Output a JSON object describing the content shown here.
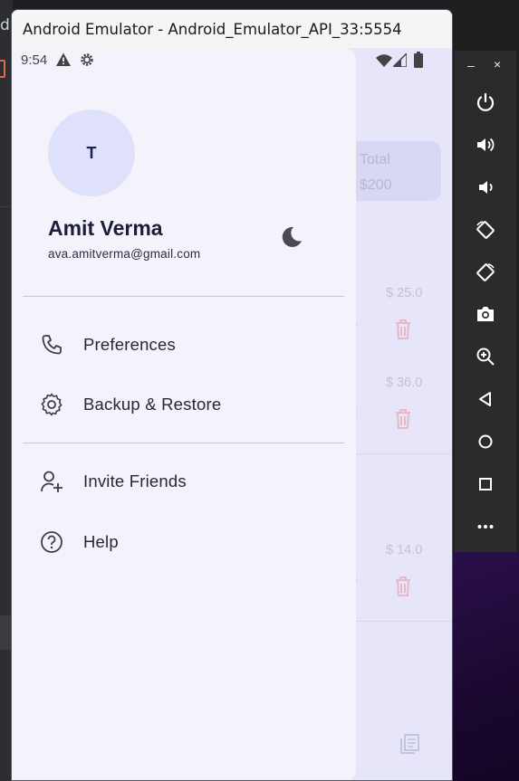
{
  "window": {
    "title": "Android Emulator - Android_Emulator_API_33:5554"
  },
  "status_bar": {
    "time": "9:54",
    "icons": [
      "warning-icon",
      "settings-icon",
      "wifi-icon",
      "signal-icon",
      "battery-icon"
    ]
  },
  "drawer": {
    "avatar_initial": "T",
    "user_name": "Amit Verma",
    "user_email": "ava.amitverma@gmail.com",
    "theme_toggle_icon": "moon-icon",
    "menu": [
      {
        "label": "Preferences",
        "icon": "phone-icon"
      },
      {
        "label": "Backup & Restore",
        "icon": "gear-icon"
      },
      {
        "label": "Invite Friends",
        "icon": "add-person-icon"
      },
      {
        "label": "Help",
        "icon": "help-circle-icon"
      }
    ]
  },
  "background_app": {
    "total_label": "Total",
    "total_value": "$200",
    "amounts": [
      "$ 25.0",
      "$ 36.0",
      "$ 14.0"
    ]
  },
  "emulator_toolbar": {
    "minimize": "–",
    "close": "×",
    "buttons": [
      "power-icon",
      "volume-up-icon",
      "volume-down-icon",
      "rotate-left-icon",
      "rotate-right-icon",
      "camera-icon",
      "zoom-icon",
      "back-icon",
      "home-icon",
      "overview-icon",
      "more-icon"
    ]
  },
  "colors": {
    "drawer_bg": "#f4f3fb",
    "avatar_bg": "#dfe1fb",
    "accent": "#1b1e3a",
    "toolbar_bg": "#2b2b2d"
  }
}
